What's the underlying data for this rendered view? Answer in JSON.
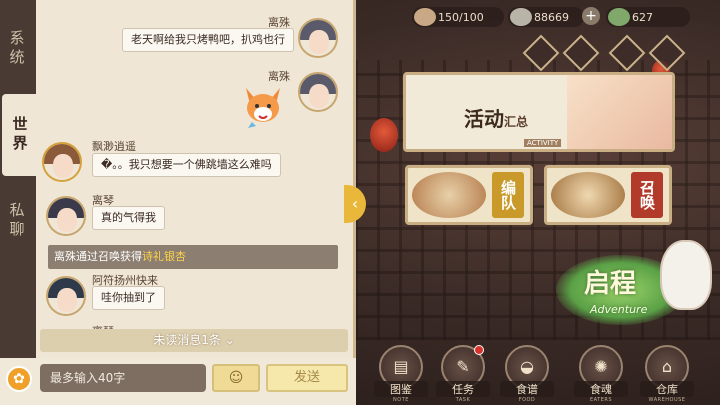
{
  "resources": {
    "stamina": "150/100",
    "coins": "88669",
    "jade": "627"
  },
  "chat": {
    "tabs": [
      "系统",
      "世界",
      "私聊"
    ],
    "active_tab": "世界",
    "messages": [
      {
        "name": "离殊",
        "text": "老天啊给我只烤鸭吧，扒鸡也行"
      },
      {
        "name": "离殊"
      },
      {
        "name": "飘渺逍遥",
        "text": "�。。我只想要一个佛跳墙这么难吗"
      },
      {
        "name": "离琴",
        "text": "真的气得我"
      },
      {
        "name": "阿符扬州快来",
        "text": "哇你抽到了"
      }
    ],
    "system_message": {
      "prefix": "离殊通过召唤获得",
      "highlight": "诗礼银杏"
    },
    "partial_name": "离琴",
    "unread_label": "未读消息1条",
    "input_placeholder": "最多输入40字",
    "send_label": "发送"
  },
  "home": {
    "activity_title": "活动",
    "activity_title_small": "汇总",
    "activity_sub": "ACTIVITY",
    "cards": [
      {
        "label": "编队",
        "color": "#c99a2a"
      },
      {
        "label": "召唤",
        "color": "#b13a2a"
      }
    ],
    "adventure_title": "启程",
    "adventure_sub": "Adventure"
  },
  "nav": [
    {
      "label": "图鉴",
      "en": "NOTE",
      "icon": "book-icon"
    },
    {
      "label": "任务",
      "en": "TASK",
      "icon": "scroll-icon",
      "badge": true
    },
    {
      "label": "食谱",
      "en": "FOOD",
      "icon": "bowl-icon"
    },
    {
      "label": "食魂",
      "en": "EATERS",
      "icon": "spirit-icon"
    },
    {
      "label": "仓库",
      "en": "WAREHOUSE",
      "icon": "warehouse-icon"
    }
  ]
}
